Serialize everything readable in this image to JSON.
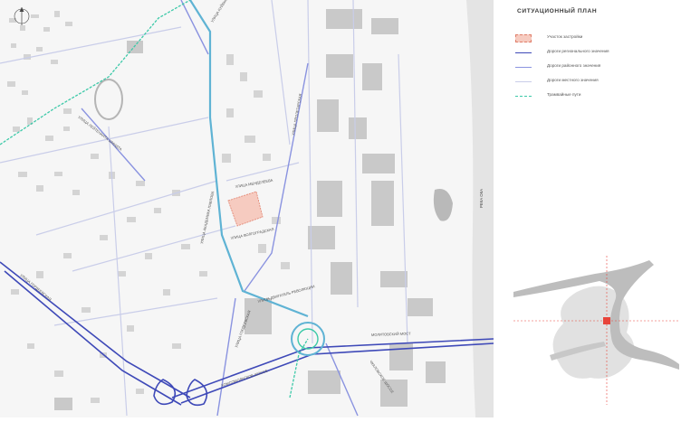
{
  "panel": {
    "title": "СИТУАЦИОННЫЙ ПЛАН"
  },
  "legend": [
    {
      "label": "Участок застройки",
      "color": "#f6cbc0",
      "kind": "area"
    },
    {
      "label": "Дороги регионального значения",
      "color": "#3e49b8",
      "kind": "line"
    },
    {
      "label": "Дороги районного значения",
      "color": "#8a93e0",
      "kind": "line"
    },
    {
      "label": "Дороги местного значения",
      "color": "#c9cde9",
      "kind": "line"
    },
    {
      "label": "Трамвайные пути",
      "color": "#3cc9a8",
      "kind": "dashed"
    }
  ],
  "map": {
    "river_label": "РЕКА ОКА",
    "bridge_label": "МОЛИТОВСКИЙ МОСТ",
    "streets": [
      "УЛИЦА КУЙБЫШЕВА",
      "УЛИЦА МЕНДЕЛЕЕВА",
      "УЛИЦА АКАДЕМИКА ПАВЛОВА",
      "УЛИЦА ЛЕЙТЕНАНТА ШМИДТА",
      "УЛИЦА ВОЛГОГРАДСКАЯ",
      "УЛИЦА ПРОЛЕТАРСКАЯ",
      "УЛИЦА ДВИГАТЕЛЬ РЕВОЛЮЦИИ",
      "УЛИЦА ГОРДЕЕВСКАЯ",
      "КОМСОМОЛЬСКОЕ ШОССЕ",
      "УЛИЦА ГОРДЕЕВСКАЯ",
      "ЧКАЛОВСКОЕ ШОССЕ"
    ]
  },
  "colors": {
    "water": "#e4e4e4",
    "buildings": "#cfcfcf",
    "site": "#f6cbc0",
    "regional_road": "#3e49b8",
    "district_road": "#8a93e0",
    "main_road": "#5fb3d4",
    "tram": "#3cc9a8"
  },
  "compass_icon": "north-arrow-icon",
  "minimap_marker_color": "#e8443a"
}
